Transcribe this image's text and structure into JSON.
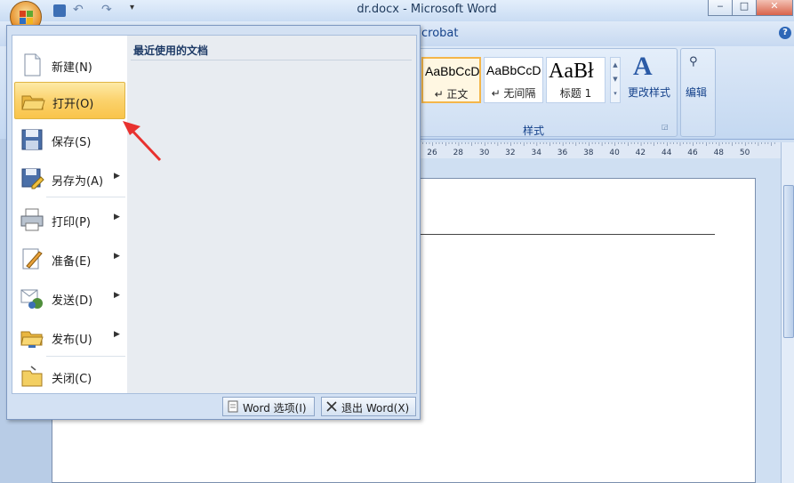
{
  "window": {
    "title": "dr.docx - Microsoft Word",
    "minimize": "‒",
    "restore": "□",
    "close": "✕"
  },
  "ribbon": {
    "tab_fragment": "crobat",
    "styles": [
      {
        "sample": "AaBbCcD",
        "name": "↵ 正文",
        "selected": true
      },
      {
        "sample": "AaBbCcD",
        "name": "↵ 无间隔",
        "selected": false
      },
      {
        "sample": "AaBł",
        "name": "标题 1",
        "selected": false
      }
    ],
    "change_styles": "更改样式",
    "edit": "编辑",
    "group_styles": "样式",
    "help": "?"
  },
  "ruler": {
    "ticks": [
      "26",
      "28",
      "30",
      "32",
      "34",
      "36",
      "38",
      "40",
      "42",
      "44",
      "46",
      "48",
      "50"
    ]
  },
  "office_menu": {
    "recent_header": "最近使用的文档",
    "items": [
      {
        "label": "新建(N)",
        "icon": "new-doc-icon",
        "arrow": false
      },
      {
        "label": "打开(O)",
        "icon": "open-folder-icon",
        "arrow": false,
        "highlighted": true
      },
      {
        "label": "保存(S)",
        "icon": "save-disk-icon",
        "arrow": false
      },
      {
        "label": "另存为(A)",
        "icon": "save-as-icon",
        "arrow": true
      },
      {
        "label": "打印(P)",
        "icon": "printer-icon",
        "arrow": true
      },
      {
        "label": "准备(E)",
        "icon": "prepare-icon",
        "arrow": true
      },
      {
        "label": "发送(D)",
        "icon": "send-icon",
        "arrow": true
      },
      {
        "label": "发布(U)",
        "icon": "publish-icon",
        "arrow": true
      },
      {
        "label": "关闭(C)",
        "icon": "close-folder-icon",
        "arrow": false
      }
    ],
    "word_options": "Word 选项(I)",
    "exit_word": "退出 Word(X)",
    "arrow_glyph": "▶"
  },
  "colors": {
    "accent": "#f9c44a",
    "annotation_arrow": "#e8312f"
  }
}
